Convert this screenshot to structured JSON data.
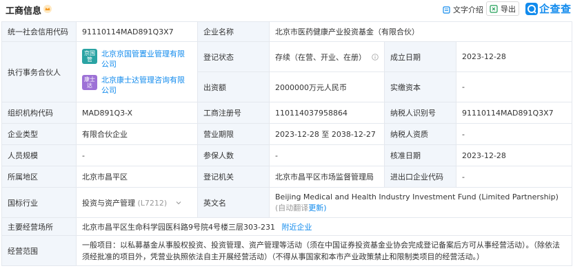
{
  "header": {
    "title": "工商信息",
    "doc_link": "文字介绍",
    "export_label": "导出",
    "brand_name": "企查查"
  },
  "colors": {
    "accent": "#128bed",
    "label_bg": "#f2f6fb",
    "border": "#e4e8ee",
    "partner1": "#2aa3a3",
    "partner2": "#9d71d6"
  },
  "rows": {
    "credit_code_label": "统一社会信用代码",
    "credit_code_value": "91110114MAD891Q3X7",
    "company_name_label": "企业名称",
    "company_name_value": "北京市医药健康产业投资基金（有限合伙）",
    "partner_label": "执行事务合伙人",
    "partner1_logo": "京国管",
    "partner1_name": "北京京国管置业管理有限公司",
    "partner2_logo": "康士达",
    "partner2_name": "北京康士达管理咨询有限公司",
    "status_label": "登记状态",
    "status_value": "存续（在营、开业、在册）",
    "established_label": "成立日期",
    "established_value": "2023-12-28",
    "capital_label": "出资额",
    "capital_value": "2000000万元人民币",
    "paid_capital_label": "实缴资本",
    "paid_capital_value": "-",
    "org_code_label": "组织机构代码",
    "org_code_value": "MAD891Q3-X",
    "reg_no_label": "工商注册号",
    "reg_no_value": "110114037958864",
    "taxpayer_id_label": "纳税人识别号",
    "taxpayer_id_value": "91110114MAD891Q3X7",
    "type_label": "企业类型",
    "type_value": "有限合伙企业",
    "term_label": "营业期限",
    "term_value": "2023-12-28 至 2038-12-27",
    "taxpayer_qual_label": "纳税人资质",
    "taxpayer_qual_value": "-",
    "staff_label": "人员规模",
    "staff_value": "-",
    "insured_label": "参保人数",
    "insured_value": "-",
    "approval_label": "核准日期",
    "approval_value": "2023-12-28",
    "region_label": "所属地区",
    "region_value": "北京市昌平区",
    "authority_label": "登记机关",
    "authority_value": "北京市昌平区市场监督管理局",
    "ie_code_label": "进出口企业代码",
    "ie_code_value": "-",
    "industry_label": "国标行业",
    "industry_value": "投资与资产管理",
    "industry_code": "(L7212)",
    "english_label": "英文名",
    "english_value": "Beijing Medical and Health Industry Investment Fund (Limited Partnership)",
    "english_note": "(自动翻译",
    "english_update": "更新)",
    "address_label": "主要经营场所",
    "address_value": "北京市昌平区生命科学园医科路9号院4号楼三层303-231",
    "nearby_link": "附近企业",
    "scope_label": "经营范围",
    "scope_value": "一般项目：以私募基金从事股权投资、投资管理、资产管理等活动（须在中国证券投资基金业协会完成登记备案后方可从事经营活动）。（除依法须经批准的项目外，凭营业执照依法自主开展经营活动）（不得从事国家和本市产业政策禁止和限制类项目的经营活动。）"
  }
}
